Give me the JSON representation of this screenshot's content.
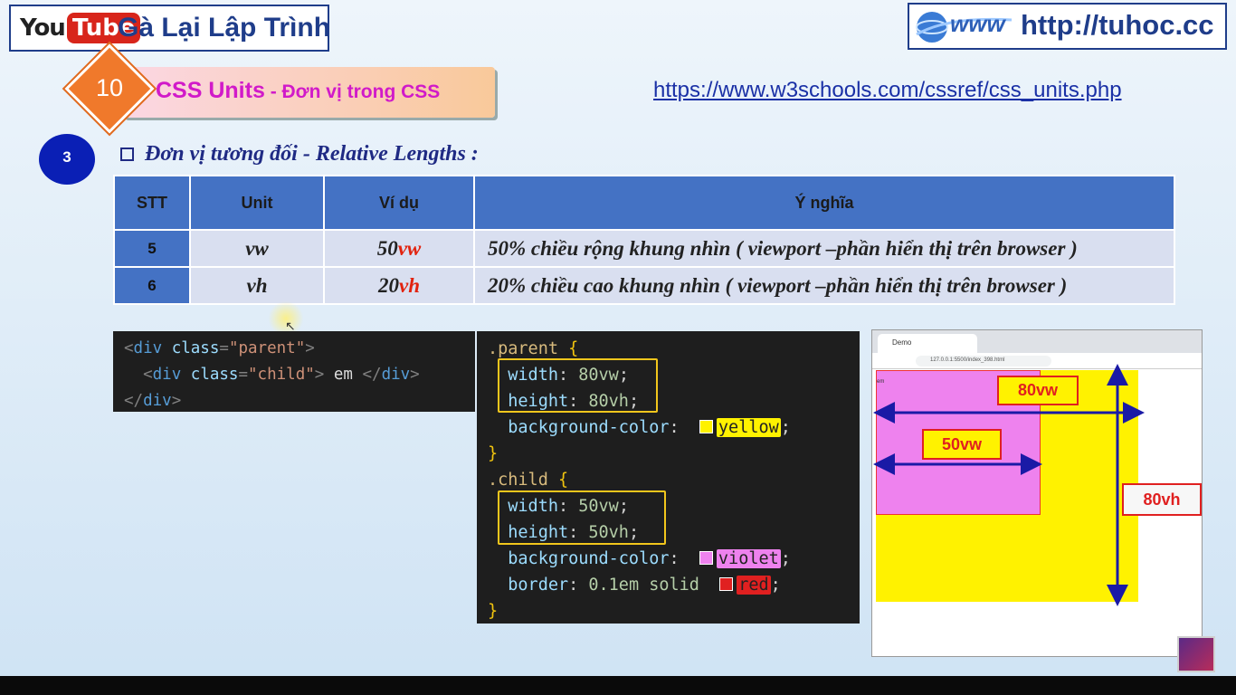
{
  "header": {
    "yt_you": "You",
    "yt_tube": "Tube",
    "channel_name": "Gà Lại Lập Trình",
    "www_logo_text": "www",
    "site_url": "http://tuhoc.cc"
  },
  "lesson": {
    "number": "10",
    "title": "CSS Units",
    "subtitle": " - Đơn vị trong CSS",
    "reference_link": "https://www.w3schools.com/cssref/css_units.php"
  },
  "section": {
    "step": "3",
    "title": "Đơn vị tương đối - Relative Lengths :"
  },
  "table": {
    "headers": [
      "STT",
      "Unit",
      "Ví dụ",
      "Ý nghĩa"
    ],
    "rows": [
      {
        "stt": "5",
        "unit": "vw",
        "example_num": "50",
        "example_unit": "vw",
        "meaning": "50% chiều rộng khung nhìn ( viewport –phần hiển thị trên browser )"
      },
      {
        "stt": "6",
        "unit": "vh",
        "example_num": "20",
        "example_unit": "vh",
        "meaning": "20% chiều cao khung nhìn ( viewport –phần hiển thị trên browser )"
      }
    ]
  },
  "html_code": {
    "line1_tag": "div",
    "line1_attr": "class",
    "line1_val": "\"parent\"",
    "line2_tag": "div",
    "line2_attr": "class",
    "line2_val": "\"child\"",
    "line2_text": " em ",
    "line3_tag": "div"
  },
  "css_code": {
    "parent_selector": ".parent",
    "parent_width": "80vw",
    "parent_height": "80vh",
    "parent_bg": "yellow",
    "child_selector": ".child",
    "child_width": "50vw",
    "child_height": "50vh",
    "child_bg": "violet",
    "child_border_value": "0.1em solid",
    "child_border_color": "red"
  },
  "browser": {
    "tab_title": "Demo",
    "url": "127.0.0.1:5500/index_398.html",
    "label_80vw": "80vw",
    "label_50vw": "50vw",
    "label_80vh": "80vh",
    "child_text": "em"
  },
  "colors": {
    "accent_blue": "#1f3d8a",
    "table_header": "#4472c4",
    "unit_red": "#e2230f",
    "parent_yellow": "#fff200",
    "child_violet": "#ee82ee"
  }
}
